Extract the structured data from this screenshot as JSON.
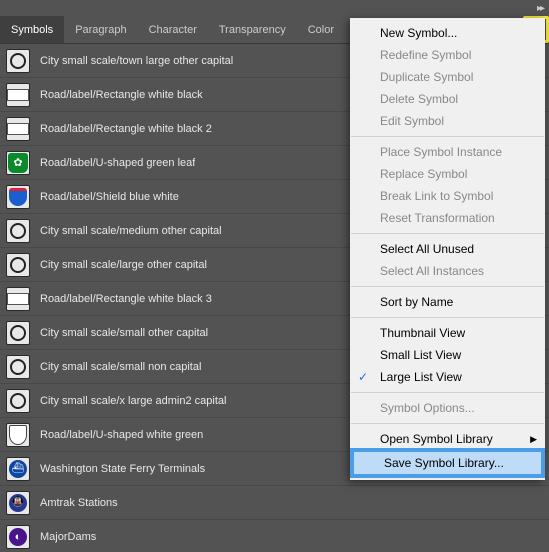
{
  "tabs": [
    "Symbols",
    "Paragraph",
    "Character",
    "Transparency",
    "Color"
  ],
  "active_tab": 0,
  "symbols": [
    {
      "label": "City small scale/town large other capital",
      "thumb": "circle"
    },
    {
      "label": "Road/label/Rectangle white black",
      "thumb": "rect"
    },
    {
      "label": "Road/label/Rectangle white black 2",
      "thumb": "rect"
    },
    {
      "label": "Road/label/U-shaped green leaf",
      "thumb": "green"
    },
    {
      "label": "Road/label/Shield blue white",
      "thumb": "blue"
    },
    {
      "label": "City small scale/medium other capital",
      "thumb": "circle"
    },
    {
      "label": "City small scale/large other capital",
      "thumb": "circle"
    },
    {
      "label": "Road/label/Rectangle white black 3",
      "thumb": "rect"
    },
    {
      "label": "City small scale/small other capital",
      "thumb": "circle"
    },
    {
      "label": "City small scale/small non capital",
      "thumb": "circle"
    },
    {
      "label": "City small scale/x large admin2 capital",
      "thumb": "circle"
    },
    {
      "label": "Road/label/U-shaped white green",
      "thumb": "whiteshield"
    },
    {
      "label": "Washington State Ferry Terminals",
      "thumb": "ferry"
    },
    {
      "label": "Amtrak Stations",
      "thumb": "amtrak"
    },
    {
      "label": "MajorDams",
      "thumb": "dam"
    }
  ],
  "menu": {
    "groups": [
      [
        {
          "label": "New Symbol...",
          "enabled": true
        },
        {
          "label": "Redefine Symbol",
          "enabled": false
        },
        {
          "label": "Duplicate Symbol",
          "enabled": false
        },
        {
          "label": "Delete Symbol",
          "enabled": false
        },
        {
          "label": "Edit Symbol",
          "enabled": false
        }
      ],
      [
        {
          "label": "Place Symbol Instance",
          "enabled": false
        },
        {
          "label": "Replace Symbol",
          "enabled": false
        },
        {
          "label": "Break Link to Symbol",
          "enabled": false
        },
        {
          "label": "Reset Transformation",
          "enabled": false
        }
      ],
      [
        {
          "label": "Select All Unused",
          "enabled": true
        },
        {
          "label": "Select All Instances",
          "enabled": false
        }
      ],
      [
        {
          "label": "Sort by Name",
          "enabled": true
        }
      ],
      [
        {
          "label": "Thumbnail View",
          "enabled": true
        },
        {
          "label": "Small List View",
          "enabled": true
        },
        {
          "label": "Large List View",
          "enabled": true,
          "checked": true
        }
      ],
      [
        {
          "label": "Symbol Options...",
          "enabled": false
        }
      ],
      [
        {
          "label": "Open Symbol Library",
          "enabled": true,
          "arrow": true
        },
        {
          "label": "Save Symbol Library...",
          "enabled": true,
          "highlighted": true
        }
      ]
    ]
  }
}
